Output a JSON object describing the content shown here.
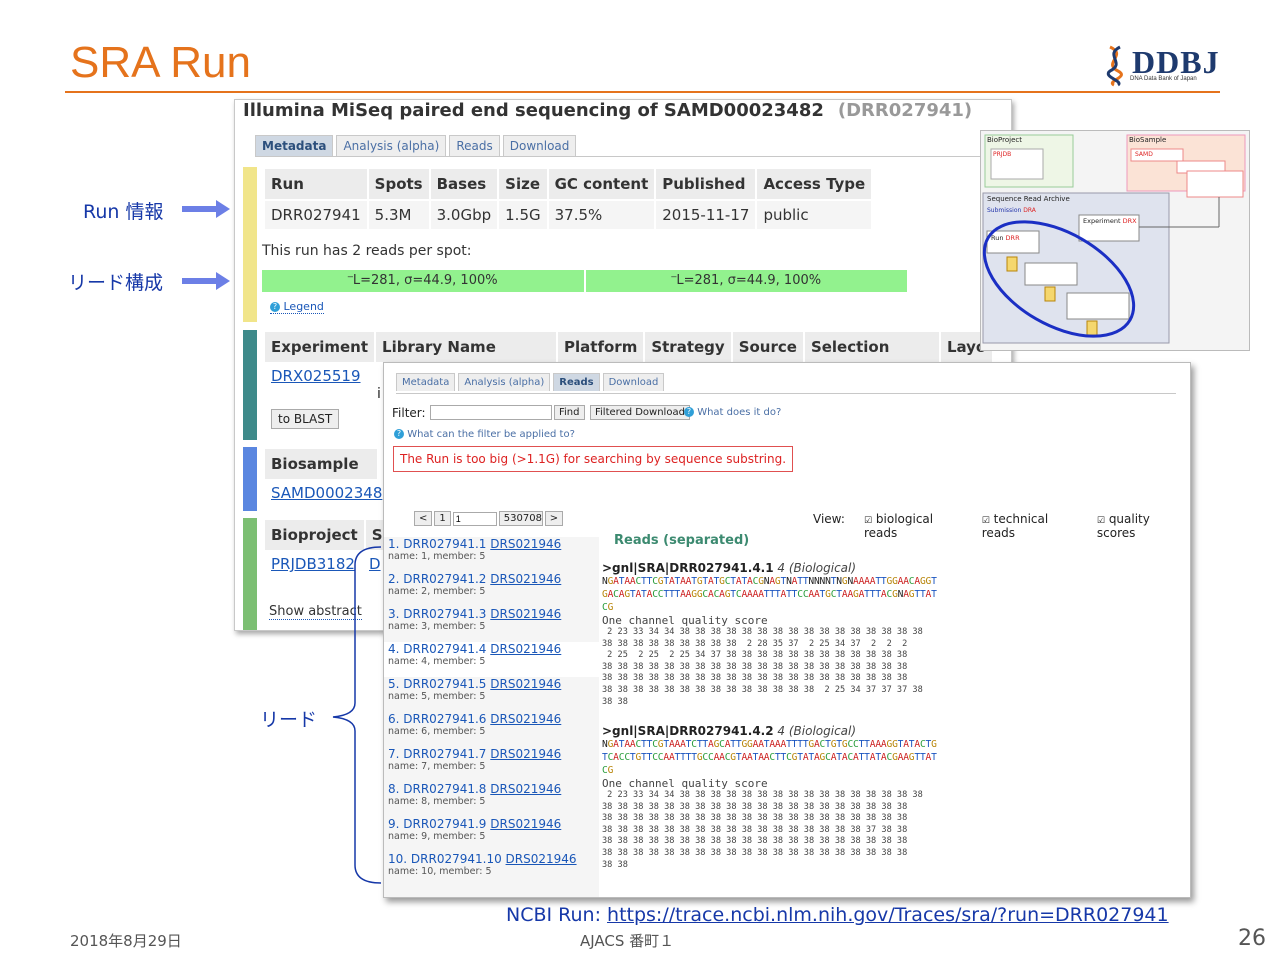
{
  "slide": {
    "title": "SRA Run",
    "logo": "DDBJ",
    "logo_sub": "DNA Data Bank of Japan",
    "footer_date": "2018年8月29日",
    "footer_center": "AJACS 番町１",
    "page_number": "26",
    "ncbi_label": "NCBI Run: ",
    "ncbi_url": "https://trace.ncbi.nlm.nih.gov/Traces/sra/?run=DRR027941"
  },
  "annotations": {
    "run_info": "Run 情報",
    "read_structure": "リード構成",
    "reads": "リード"
  },
  "run_page": {
    "title": "Illumina MiSeq paired end sequencing of SAMD00023482",
    "accession": "(DRR027941)",
    "tabs": [
      "Metadata",
      "Analysis (alpha)",
      "Reads",
      "Download"
    ],
    "run_table": {
      "headers": [
        "Run",
        "Spots",
        "Bases",
        "Size",
        "GC content",
        "Published",
        "Access Type"
      ],
      "row": [
        "DRR027941",
        "5.3M",
        "3.0Gbp",
        "1.5G",
        "37.5%",
        "2015-11-17",
        "public"
      ]
    },
    "reads_per_spot": "This run has 2 reads per spot:",
    "read_segments": [
      "L=281, σ=44.9, 100%",
      "L=281, σ=44.9, 100%"
    ],
    "legend": "Legend",
    "experiment_headers": [
      "Experiment",
      "Library Name",
      "Platform",
      "Strategy",
      "Source",
      "Selection",
      "Layo"
    ],
    "experiment_link": "DRX025519",
    "experiment_extra": "i",
    "blast_button": "to BLAST",
    "biosample_header": "Biosample",
    "biosample_link": "SAMD0002348",
    "bioproject_headers": [
      "Bioproject",
      "SI"
    ],
    "bioproject_link": "PRJDB3182",
    "bioproject_extra": "D",
    "show_abstract": "Show abstract"
  },
  "reads_page": {
    "tabs": [
      "Metadata",
      "Analysis (alpha)",
      "Reads",
      "Download"
    ],
    "filter_label": "Filter:",
    "filter_value": "",
    "find_button": "Find",
    "filtered_download_button": "Filtered Download",
    "what_does": "What does it do?",
    "what_filter": "What can the filter be applied to?",
    "too_big": "The Run is too big (>1.1G) for searching by sequence substring.",
    "pager": {
      "prev": "<",
      "first": "1",
      "current": "1",
      "total": "530708",
      "next": ">"
    },
    "view_label": "View:",
    "view_options": [
      "biological reads",
      "technical reads",
      "quality scores"
    ],
    "reads_heading": "Reads (separated)",
    "list": [
      {
        "acc": "1. DRR027941.1",
        "drs": "DRS021946",
        "sub": "name: 1, member: 5"
      },
      {
        "acc": "2. DRR027941.2",
        "drs": "DRS021946",
        "sub": "name: 2, member: 5"
      },
      {
        "acc": "3. DRR027941.3",
        "drs": "DRS021946",
        "sub": "name: 3, member: 5"
      },
      {
        "acc": "4. DRR027941.4",
        "drs": "DRS021946",
        "sub": "name: 4, member: 5"
      },
      {
        "acc": "5. DRR027941.5",
        "drs": "DRS021946",
        "sub": "name: 5, member: 5"
      },
      {
        "acc": "6. DRR027941.6",
        "drs": "DRS021946",
        "sub": "name: 6, member: 5"
      },
      {
        "acc": "7. DRR027941.7",
        "drs": "DRS021946",
        "sub": "name: 7, member: 5"
      },
      {
        "acc": "8. DRR027941.8",
        "drs": "DRS021946",
        "sub": "name: 8, member: 5"
      },
      {
        "acc": "9. DRR027941.9",
        "drs": "DRS021946",
        "sub": "name: 9, member: 5"
      },
      {
        "acc": "10. DRR027941.10",
        "drs": "DRS021946",
        "sub": "name: 10, member: 5"
      }
    ],
    "read1_header": ">gnl|SRA|DRR027941.4.1",
    "read1_tag": "4 (Biological)",
    "read1_seq": [
      "NGATAACTTCGTATAATGTATGCTATACGNAGTNATTNNNNTNGNAAAATTGGAACAGGT",
      "GACAGTATACCTTTAAGGCACAGTCAAAATTTATTCCAATGCTAAGATTTACGNAGTTAT",
      "CG"
    ],
    "read1_quality_label": "One channel quality score",
    "read1_quality": [
      " 2 23 33 34 34 38 38 38 38 38 38 38 38 38 38 38 38 38 38 38 38",
      "38 38 38 38 38 38 38 38 38  2 28 35 37  2 25 34 37  2  2  2",
      " 2 25  2 25  2 25 34 37 38 38 38 38 38 38 38 38 38 38 38 38",
      "38 38 38 38 38 38 38 38 38 38 38 38 38 38 38 38 38 38 38 38",
      "38 38 38 38 38 38 38 38 38 38 38 38 38 38 38 38 38 38 38 38",
      "38 38 38 38 38 38 38 38 38 38 38 38 38 38  2 25 34 37 37 37 38",
      "38 38"
    ],
    "read2_header": ">gnl|SRA|DRR027941.4.2",
    "read2_tag": "4 (Biological)",
    "read2_seq": [
      "NGATAACTTCGTAAATCTTAGCATTGGAATAAATTTTGACTGTGCCTTAAAGGTATACTG",
      "TCACCTGTTCCAATTTTGCCAACGTAATAACTTCGTATAGCATACATTATACGAAGTTAT",
      "CG"
    ],
    "read2_quality_label": "One channel quality score",
    "read2_quality": [
      " 2 23 33 34 34 38 38 38 38 38 38 38 38 38 38 38 38 38 38 38 38",
      "38 38 38 38 38 38 38 38 38 38 38 38 38 38 38 38 38 38 38 38",
      "38 38 38 38 38 38 38 38 38 38 38 38 38 38 38 38 38 38 38 38",
      "38 38 38 38 38 38 38 38 38 38 38 38 38 38 38 38 38 37 38 38",
      "38 38 38 38 38 38 38 38 38 38 38 38 38 38 38 38 38 38 38 38",
      "38 38 38 38 38 38 38 38 38 38 38 38 38 38 38 38 38 38 38 38",
      "38 38"
    ]
  },
  "diagram": {
    "bioproject": "BioProject",
    "biosample": "BioSample",
    "sra": "Sequence Read Archive",
    "submission": "Submission",
    "experiment": "Experiment",
    "run": "Run",
    "prefix_dra": "DRA",
    "prefix_drx": "DRX",
    "prefix_drr": "DRR",
    "prefix_prjdb": "PRJDB",
    "prefix_samd": "SAMD"
  }
}
